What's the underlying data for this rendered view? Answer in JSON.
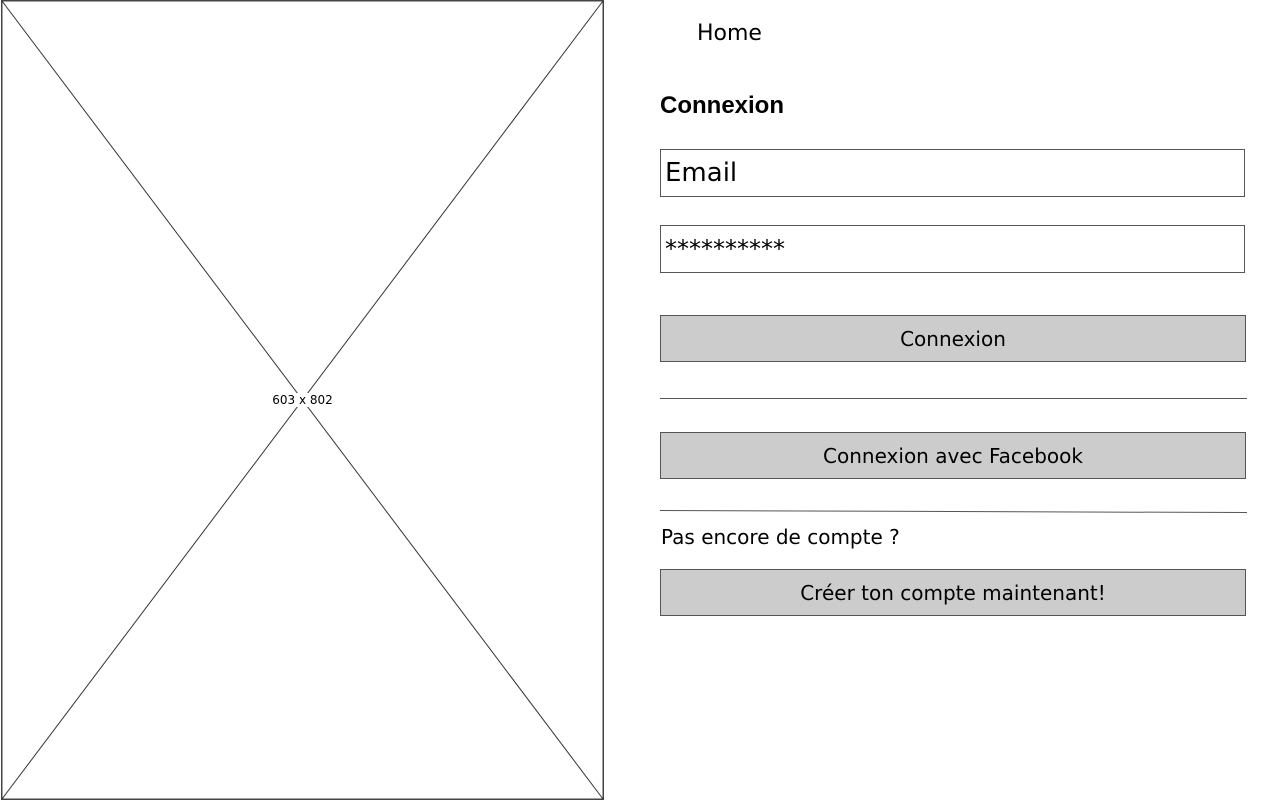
{
  "image_placeholder": {
    "dimensions_label": "603 x 802"
  },
  "nav": {
    "home_label": "Home"
  },
  "login_form": {
    "title": "Connexion",
    "email_placeholder": "Email",
    "password_value": "**********",
    "login_button_label": "Connexion",
    "facebook_button_label": "Connexion avec Facebook",
    "no_account_text": "Pas encore de compte ?",
    "create_account_button_label": "Créer ton compte maintenant!"
  },
  "colors": {
    "button_background": "#cccccc",
    "border": "#555555",
    "background": "#ffffff"
  }
}
